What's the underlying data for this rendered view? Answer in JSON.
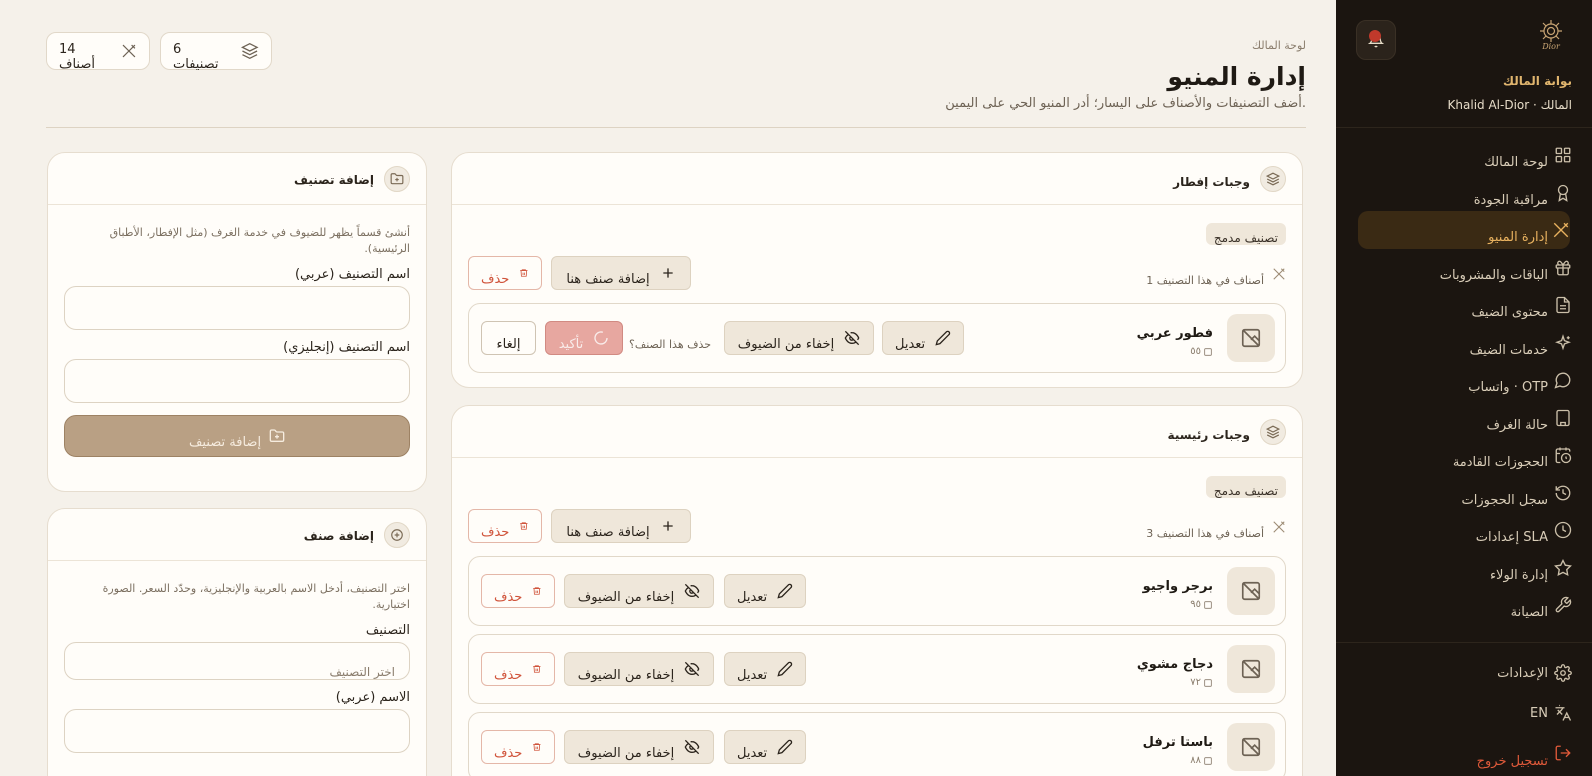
{
  "sidebar": {
    "portal_title": "بوابة المالك",
    "user_line": "Khalid Al-Dior · المالك",
    "logo_text": "Dior",
    "nav": [
      {
        "label": "لوحة المالك",
        "icon": "grid-icon",
        "active": false
      },
      {
        "label": "مراقبة الجودة",
        "icon": "award-icon",
        "active": false
      },
      {
        "label": "إدارة المنيو",
        "icon": "utensils-icon",
        "active": true
      },
      {
        "label": "الباقات والمشروبات",
        "icon": "gift-icon",
        "active": false
      },
      {
        "label": "محتوى الضيف",
        "icon": "document-icon",
        "active": false
      },
      {
        "label": "خدمات الضيف",
        "icon": "sparkles-icon",
        "active": false
      },
      {
        "label": "واتساب · OTP",
        "icon": "chat-icon",
        "active": false
      },
      {
        "label": "حالة الغرف",
        "icon": "building-icon",
        "active": false
      },
      {
        "label": "الحجوزات القادمة",
        "icon": "calendar-clock-icon",
        "active": false
      },
      {
        "label": "سجل الحجوزات",
        "icon": "history-icon",
        "active": false
      },
      {
        "label": "إعدادات SLA",
        "icon": "clock-icon",
        "active": false
      },
      {
        "label": "إدارة الولاء",
        "icon": "star-icon",
        "active": false
      },
      {
        "label": "الصيانة",
        "icon": "wrench-icon",
        "active": false
      }
    ],
    "bottom": {
      "settings": "الإعدادات",
      "language": "EN",
      "logout": "تسجيل خروج"
    }
  },
  "header": {
    "breadcrumb": "لوحة المالك",
    "title": "إدارة المنيو",
    "subtitle": "أضف التصنيفات والأصناف على اليسار؛ أدر المنيو الحي على اليمين.",
    "stats": {
      "items": "14 أصناف",
      "categories": "6 تصنيفات"
    }
  },
  "add_category": {
    "title": "إضافة تصنيف",
    "hint": "أنشئ قسماً يظهر للضيوف في خدمة الغرف (مثل الإفطار، الأطباق الرئيسية).",
    "name_ar_label": "اسم التصنيف (عربي)",
    "name_en_label": "اسم التصنيف (إنجليزي)",
    "button": "إضافة تصنيف"
  },
  "add_item": {
    "title": "إضافة صنف",
    "hint": "اختر التصنيف، أدخل الاسم بالعربية والإنجليزية، وحدّد السعر. الصورة اختيارية.",
    "category_label": "التصنيف",
    "category_placeholder": "اختر التصنيف",
    "name_ar_label": "الاسم (عربي)"
  },
  "categories": [
    {
      "title": "وجبات إفطار",
      "tag": "تصنيف مدمج",
      "count": "1 أصناف في هذا التصنيف",
      "add_item": "إضافة صنف هنا",
      "delete": "حذف",
      "items": [
        {
          "name": "فطور عربي",
          "price": "٥٥",
          "edit": "تعديل",
          "hide": "إخفاء من الضيوف",
          "confirm_question": "حذف هذا الصنف؟",
          "confirm": "تأكيد",
          "cancel": "إلغاء"
        }
      ]
    },
    {
      "title": "وجبات رئيسية",
      "tag": "تصنيف مدمج",
      "count": "3 أصناف في هذا التصنيف",
      "add_item": "إضافة صنف هنا",
      "delete": "حذف",
      "items": [
        {
          "name": "برجر واجيو",
          "price": "٩٥",
          "edit": "تعديل",
          "hide": "إخفاء من الضيوف",
          "delete": "حذف"
        },
        {
          "name": "دجاج مشوي",
          "price": "٧٢",
          "edit": "تعديل",
          "hide": "إخفاء من الضيوف",
          "delete": "حذف"
        },
        {
          "name": "باستا ترفل",
          "price": "٨٨",
          "edit": "تعديل",
          "hide": "إخفاء من الضيوف",
          "delete": "حذف"
        }
      ]
    }
  ],
  "colors": {
    "sidebar_bg": "#1b1510",
    "accent": "#e9b25f",
    "page_bg": "#f5f1ea",
    "danger": "#d0533a"
  }
}
